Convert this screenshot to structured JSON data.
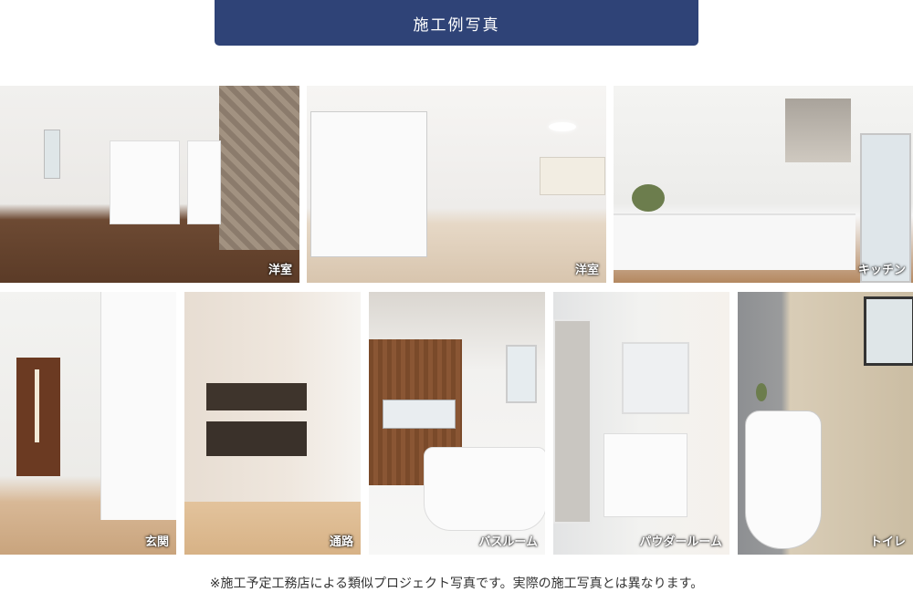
{
  "header": {
    "title": "施工例写真"
  },
  "photos": [
    {
      "caption": "洋室"
    },
    {
      "caption": "洋室"
    },
    {
      "caption": "キッチン"
    },
    {
      "caption": "玄関"
    },
    {
      "caption": "通路"
    },
    {
      "caption": "バスルーム"
    },
    {
      "caption": "パウダールーム"
    },
    {
      "caption": "トイレ"
    }
  ],
  "footer": {
    "note": "※施工予定工務店による類似プロジェクト写真です。実際の施工写真とは異なります。"
  },
  "colors": {
    "header_bg": "#2f4377",
    "header_text": "#ffffff"
  }
}
